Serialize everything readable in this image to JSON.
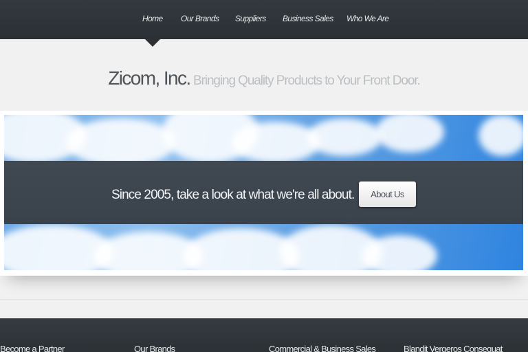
{
  "nav": {
    "items": [
      {
        "label": "Home",
        "active": true
      },
      {
        "label": "Our Brands"
      },
      {
        "label": "Suppliers"
      },
      {
        "label": "Business Sales"
      },
      {
        "label": "Who We Are"
      }
    ]
  },
  "header": {
    "site_name": "Zicom, Inc.",
    "tagline": "Bringing Quality Products to Your Front Door."
  },
  "banner": {
    "message": "Since 2005, take a look at what we're all about.",
    "button_label": "About Us"
  },
  "footer": {
    "columns": [
      {
        "heading": "Become a Partner"
      },
      {
        "heading": "Our Brands"
      },
      {
        "heading": "Commercial & Business Sales"
      },
      {
        "heading": "Blandit Vergeros Consequat"
      }
    ]
  },
  "colors": {
    "nav_background": "#2c3136",
    "band_background": "#3d4650",
    "page_background": "#f1f1f1",
    "sky_blue": "#5fa0e3"
  }
}
